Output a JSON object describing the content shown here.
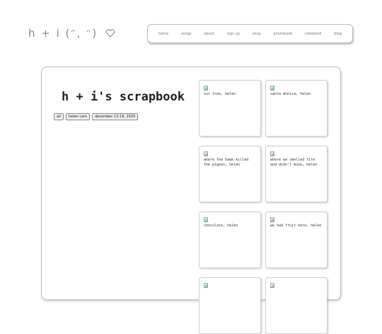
{
  "header": {
    "logo_text": "h + i (ᵔ, ᵔ)",
    "nav": [
      "home",
      "songs",
      "about",
      "sign up",
      "shop",
      "photobook",
      "notebook",
      "blog"
    ]
  },
  "page": {
    "title": "h + i's scrapbook",
    "filters": [
      "all",
      "helen cam",
      "december 13-18, 2025"
    ]
  },
  "photos": [
    {
      "caption": "our tree, helen"
    },
    {
      "caption": "santa monica, helen"
    },
    {
      "caption": "where the hawk killed the pigeon, helen"
    },
    {
      "caption": "where we smelled fire and didn't move, helen"
    },
    {
      "caption": "chocolate, helen"
    },
    {
      "caption": "we had fruit here, helen"
    },
    {
      "caption": ""
    },
    {
      "caption": ""
    }
  ],
  "colors": {
    "logo": "#888888",
    "border": "#bdbdbd",
    "text": "#222222"
  }
}
